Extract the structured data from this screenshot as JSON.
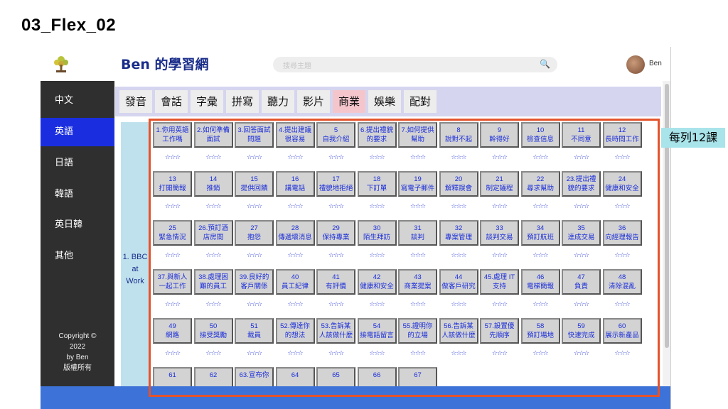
{
  "slide_title": "03_Flex_02",
  "header": {
    "site_title": "Ben 的學習網",
    "search_placeholder": "搜尋主題",
    "user_name": "Ben"
  },
  "sidebar": {
    "items": [
      {
        "label": "中文",
        "active": false
      },
      {
        "label": "英語",
        "active": true
      },
      {
        "label": "日語",
        "active": false
      },
      {
        "label": "韓語",
        "active": false
      },
      {
        "label": "英日韓",
        "active": false
      },
      {
        "label": "其他",
        "active": false
      }
    ],
    "copyright_lines": [
      "Copyright ©",
      "2022",
      "by Ben",
      "版權所有"
    ]
  },
  "tabs": [
    {
      "label": "發音",
      "active": false
    },
    {
      "label": "會話",
      "active": false
    },
    {
      "label": "字彙",
      "active": false
    },
    {
      "label": "拼寫",
      "active": false
    },
    {
      "label": "聽力",
      "active": false
    },
    {
      "label": "影片",
      "active": false
    },
    {
      "label": "商業",
      "active": true
    },
    {
      "label": "娛樂",
      "active": false
    },
    {
      "label": "配對",
      "active": false
    }
  ],
  "category": {
    "label_lines": [
      "1. BBC",
      "at",
      "Work"
    ]
  },
  "rating": "☆☆☆",
  "lessons": [
    [
      "1.你用英語",
      "工作嗎"
    ],
    [
      "2.如何準備",
      "面試"
    ],
    [
      "3.回答面試",
      "問題"
    ],
    [
      "4.提出建議",
      "很容易"
    ],
    [
      "5",
      "自我介紹"
    ],
    [
      "6.提出禮貌",
      "的要求"
    ],
    [
      "7.如何提供",
      "幫助"
    ],
    [
      "8",
      "說對不起"
    ],
    [
      "9",
      "幹得好"
    ],
    [
      "10",
      "檢查信息"
    ],
    [
      "11",
      "不同意"
    ],
    [
      "12",
      "長時間工作"
    ],
    [
      "13",
      "打開簡報"
    ],
    [
      "14",
      "推銷"
    ],
    [
      "15",
      "提供回饋"
    ],
    [
      "16",
      "講電話"
    ],
    [
      "17",
      "禮貌地拒絕"
    ],
    [
      "18",
      "下訂單"
    ],
    [
      "19",
      "寫電子郵件"
    ],
    [
      "20",
      "解釋誤會"
    ],
    [
      "21",
      "制定議程"
    ],
    [
      "22",
      "尋求幫助"
    ],
    [
      "23.提出禮",
      "貌的要求"
    ],
    [
      "24",
      "健康和安全"
    ],
    [
      "25",
      "緊急情況"
    ],
    [
      "26.預訂酒",
      "店房間"
    ],
    [
      "27",
      "抱怨"
    ],
    [
      "28",
      "傳遞壞消息"
    ],
    [
      "29",
      "保持專業"
    ],
    [
      "30",
      "陌生拜訪"
    ],
    [
      "31",
      "談判"
    ],
    [
      "32",
      "專案管理"
    ],
    [
      "33",
      "談判交易"
    ],
    [
      "34",
      "預訂航班"
    ],
    [
      "35",
      "達成交易"
    ],
    [
      "36",
      "向經理報告"
    ],
    [
      "37.與新人",
      "一起工作"
    ],
    [
      "38.處理困",
      "難的員工"
    ],
    [
      "39.良好的",
      "客戶關係"
    ],
    [
      "40",
      "員工紀律"
    ],
    [
      "41",
      "有評價"
    ],
    [
      "42",
      "健康和安全"
    ],
    [
      "43",
      "商業提案"
    ],
    [
      "44",
      "做客戶研究"
    ],
    [
      "45.處理 IT",
      "支持"
    ],
    [
      "46",
      "電梯簡報"
    ],
    [
      "47",
      "負責"
    ],
    [
      "48",
      "清除混亂"
    ],
    [
      "49",
      "網路"
    ],
    [
      "50",
      "接受獎勵"
    ],
    [
      "51",
      "裁員"
    ],
    [
      "52.傳達你",
      "的想法"
    ],
    [
      "53.告訴某",
      "人該做什麼"
    ],
    [
      "54",
      "接電話留言"
    ],
    [
      "55.證明你",
      "的立場"
    ],
    [
      "56.告訴某",
      "人該做什麼"
    ],
    [
      "57.設置優",
      "先順序"
    ],
    [
      "58",
      "預訂場地"
    ],
    [
      "59",
      "快速完成"
    ],
    [
      "60",
      "展示新產品"
    ],
    [
      "61",
      ""
    ],
    [
      "62",
      ""
    ],
    [
      "63.宣布你",
      ""
    ],
    [
      "64",
      ""
    ],
    [
      "65",
      ""
    ],
    [
      "66",
      ""
    ],
    [
      "67",
      ""
    ]
  ],
  "annotation_note": "每列12課",
  "colors": {
    "accent_blue": "#1a2ee0",
    "title_blue": "#1a2d8a",
    "highlight_red": "#e4532b",
    "note_bg": "#a9e4ea",
    "tab_active": "#f4c6cc"
  }
}
